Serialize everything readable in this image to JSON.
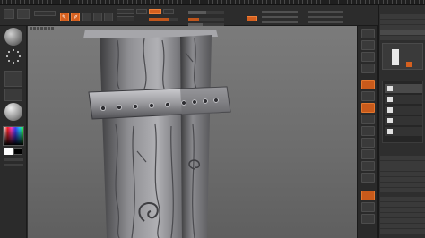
{
  "menubar": {
    "segments": [
      "",
      "",
      "",
      "",
      "",
      "",
      ""
    ]
  },
  "toolbar": {
    "zadd_label": "",
    "zsub_label": "",
    "focal_label": "",
    "draw_size_label": "",
    "active_points_label": "",
    "total_points_label": ""
  },
  "tray": {
    "tool_name": "",
    "subtool_label": "",
    "list_label": ""
  },
  "colors": {
    "accent": "#d5601f",
    "background": "#2b2b2b",
    "canvas": "#737373"
  }
}
